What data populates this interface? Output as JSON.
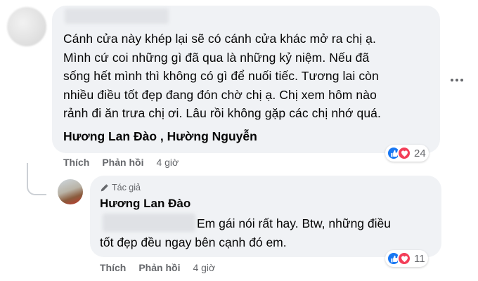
{
  "comment": {
    "lines": [
      "Cánh cửa này khép lại sẽ có cánh cửa khác mở ra chị ạ.",
      "Mình cứ coi những gì đã qua là những kỷ niệm. Nếu đã",
      "sống hết mình thì không có gì để nuối tiếc. Tương lai còn",
      "nhiều điều tốt đẹp đang đón chờ chị ạ. Chị xem hôm nào",
      "rảnh đi ăn trưa chị ơi. Lâu rồi không gặp các chị nhớ quá."
    ],
    "mentions": [
      "Hương Lan Đào",
      "Hường Nguyễn"
    ],
    "mention_separator": " , ",
    "reaction_count": "24",
    "actions": {
      "like": "Thích",
      "reply": "Phản hồi"
    },
    "timestamp": "4 giờ"
  },
  "reply": {
    "badge": "Tác giả",
    "author": "Hương Lan Đào",
    "lines": [
      "Em gái nói rất hay. Btw, những điều",
      "tốt đẹp đều ngay bên cạnh đó em."
    ],
    "reaction_count": "11",
    "actions": {
      "like": "Thích",
      "reply": "Phản hồi"
    },
    "timestamp": "4 giờ"
  },
  "colors": {
    "bubble": "#f0f2f5",
    "text": "#050505",
    "secondary_text": "#65676b",
    "like": "#1877f2",
    "love": "#f33e58"
  },
  "icons": [
    "like-reaction-icon",
    "love-reaction-icon",
    "pencil-icon",
    "more-options-icon"
  ]
}
